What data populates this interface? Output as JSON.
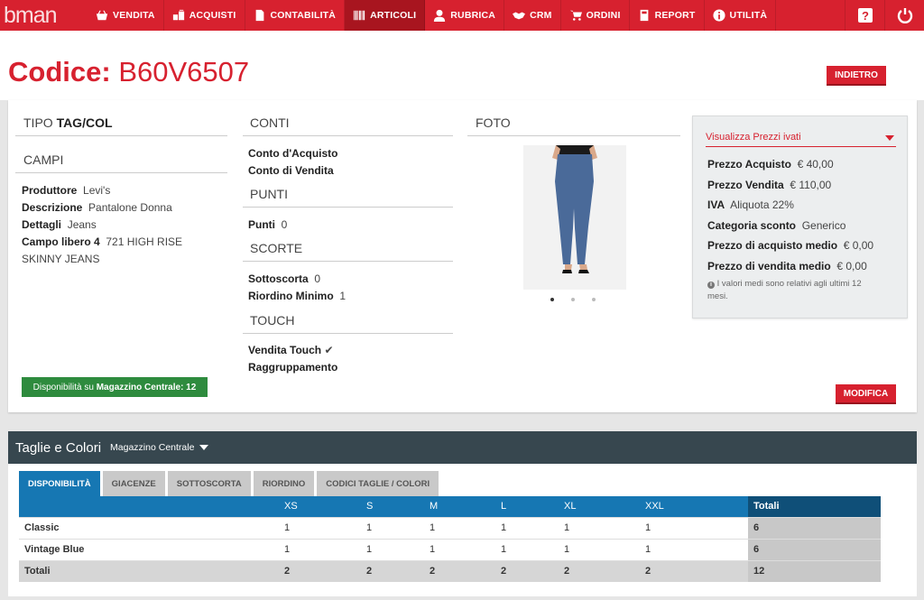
{
  "app": {
    "logo": "bman"
  },
  "nav": [
    {
      "label": "VENDITA",
      "icon": "basket-icon"
    },
    {
      "label": "ACQUISTI",
      "icon": "boxes-icon"
    },
    {
      "label": "CONTABILITÀ",
      "icon": "document-icon"
    },
    {
      "label": "ARTICOLI",
      "icon": "barcode-icon",
      "active": true
    },
    {
      "label": "RUBRICA",
      "icon": "user-icon"
    },
    {
      "label": "CRM",
      "icon": "handshake-icon"
    },
    {
      "label": "ORDINI",
      "icon": "cart-icon"
    },
    {
      "label": "REPORT",
      "icon": "calculator-icon"
    },
    {
      "label": "UTILITÀ",
      "icon": "info-icon"
    }
  ],
  "header": {
    "code_label": "Codice:",
    "code_value": "B60V6507",
    "back_button": "INDIETRO"
  },
  "tipo": {
    "label": "TIPO",
    "value": "TAG/COL"
  },
  "campi": {
    "title": "CAMPI",
    "produttore_label": "Produttore",
    "produttore": "Levi's",
    "descrizione_label": "Descrizione",
    "descrizione": "Pantalone Donna",
    "dettagli_label": "Dettagli",
    "dettagli": "Jeans",
    "campo_libero_label": "Campo libero 4",
    "campo_libero_1": "721 HIGH RISE",
    "campo_libero_2": "SKINNY JEANS"
  },
  "conti": {
    "title": "CONTI",
    "conto_acquisto": "Conto d'Acquisto",
    "conto_vendita": "Conto di Vendita"
  },
  "punti": {
    "title": "PUNTI",
    "label": "Punti",
    "value": "0"
  },
  "scorte": {
    "title": "SCORTE",
    "sottoscorta_label": "Sottoscorta",
    "sottoscorta": "0",
    "riordino_label": "Riordino Minimo",
    "riordino": "1"
  },
  "touch": {
    "title": "TOUCH",
    "vendita_touch": "Vendita Touch",
    "raggruppamento": "Raggruppamento"
  },
  "foto": {
    "title": "FOTO"
  },
  "prices": {
    "select": "Visualizza Prezzi ivati",
    "acquisto_label": "Prezzo Acquisto",
    "acquisto": "€ 40,00",
    "vendita_label": "Prezzo Vendita",
    "vendita": "€ 110,00",
    "iva_label": "IVA",
    "iva": "Aliquota 22%",
    "categoria_label": "Categoria sconto",
    "categoria": "Generico",
    "acq_medio_label": "Prezzo di acquisto medio",
    "acq_medio": "€ 0,00",
    "vend_medio_label": "Prezzo di vendita medio",
    "vend_medio": "€ 0,00",
    "note_1": "I valori medi sono relativi agli ultimi 12",
    "note_2": "mesi."
  },
  "availability": {
    "prefix": "Disponibilità su",
    "warehouse": "Magazzino Centrale",
    "qty": ": 12"
  },
  "modify_button": "MODIFICA",
  "sizes": {
    "title": "Taglie e Colori",
    "warehouse": "Magazzino Centrale",
    "tabs": [
      "DISPONIBILITÀ",
      "GIACENZE",
      "SOTTOSCORTA",
      "RIORDINO",
      "CODICI TAGLIE / COLORI"
    ],
    "columns": [
      "",
      "XS",
      "S",
      "M",
      "L",
      "XL",
      "XXL",
      "Totali"
    ],
    "rows": [
      {
        "name": "Classic",
        "values": [
          "1",
          "1",
          "1",
          "1",
          "1",
          "1"
        ],
        "total": "6"
      },
      {
        "name": "Vintage Blue",
        "values": [
          "1",
          "1",
          "1",
          "1",
          "1",
          "1"
        ],
        "total": "6"
      }
    ],
    "totals": {
      "name": "Totali",
      "values": [
        "2",
        "2",
        "2",
        "2",
        "2",
        "2"
      ],
      "total": "12"
    }
  }
}
